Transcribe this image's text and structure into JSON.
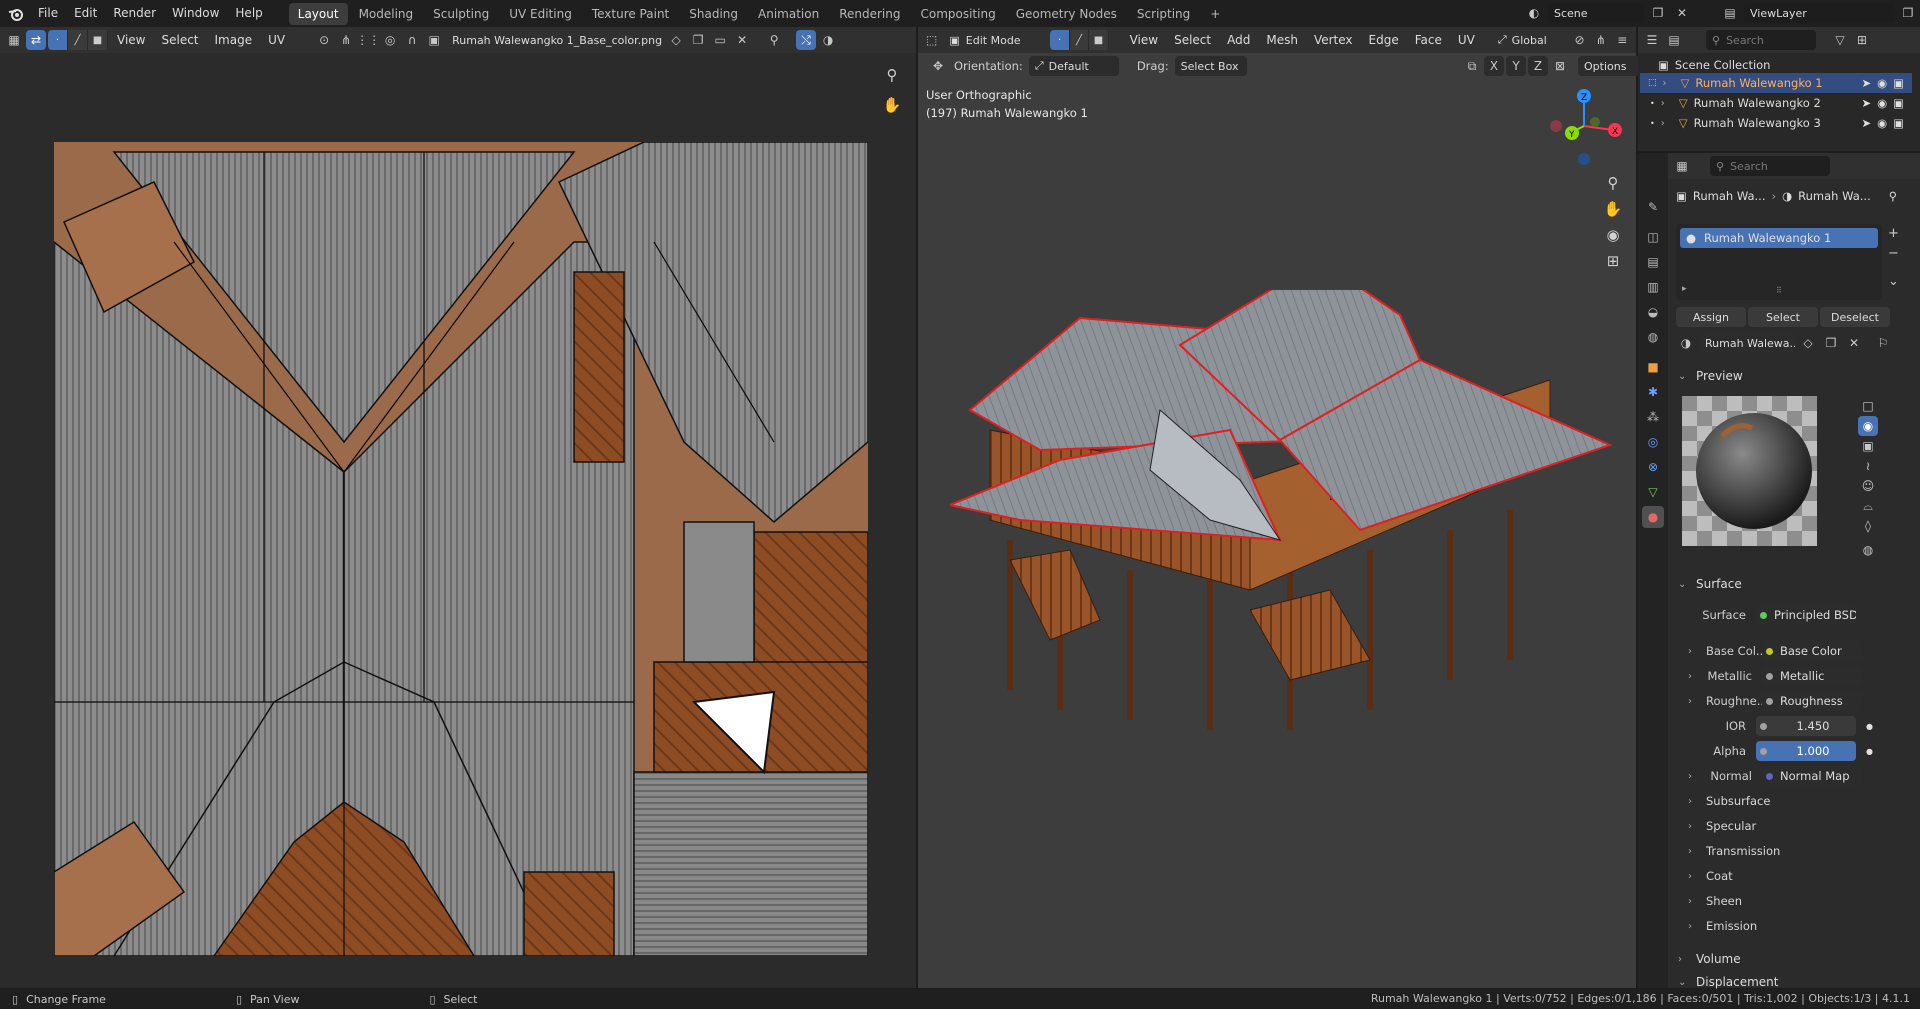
{
  "app": {
    "logo": "blender-logo"
  },
  "menu": [
    "File",
    "Edit",
    "Render",
    "Window",
    "Help"
  ],
  "workspaces": [
    "Layout",
    "Modeling",
    "Sculpting",
    "UV Editing",
    "Texture Paint",
    "Shading",
    "Animation",
    "Rendering",
    "Compositing",
    "Geometry Nodes",
    "Scripting"
  ],
  "workspace_active": "Layout",
  "add_workspace": "+",
  "scene": {
    "label": "Scene"
  },
  "view_layer": {
    "label": "ViewLayer"
  },
  "uv_editor": {
    "menus": [
      "View",
      "Select",
      "Image",
      "UV"
    ],
    "image_name": "Rumah Walewangko 1_Base_color.png"
  },
  "viewport": {
    "mode": "Edit Mode",
    "menus": [
      "View",
      "Select",
      "Add",
      "Mesh",
      "Vertex",
      "Edge",
      "Face",
      "UV"
    ],
    "transform_orientation": "Global",
    "orientation_label": "Orientation:",
    "orientation_value": "Default",
    "drag_label": "Drag:",
    "drag_value": "Select Box",
    "options_label": "Options",
    "axes": [
      "X",
      "Y",
      "Z"
    ],
    "view_name": "User Orthographic",
    "object_info": "(197) Rumah Walewangko 1"
  },
  "outliner": {
    "search_placeholder": "Search",
    "root": "Scene Collection",
    "items": [
      "Rumah Walewangko 1",
      "Rumah Walewangko 2",
      "Rumah Walewangko 3"
    ]
  },
  "properties": {
    "search_placeholder": "Search",
    "breadcrumb": [
      "Rumah Wa...",
      "Rumah Wa..."
    ],
    "material_slot": "Rumah Walewangko 1",
    "buttons": {
      "assign": "Assign",
      "select": "Select",
      "deselect": "Deselect"
    },
    "material_name": "Rumah Walewa...",
    "panels": {
      "preview": "Preview",
      "surface": "Surface"
    },
    "surface": {
      "label": "Surface",
      "value": "Principled BSDF"
    },
    "inputs": [
      {
        "label": "Base Col...",
        "value": "Base Color",
        "socket": "#c7c729"
      },
      {
        "label": "Metallic",
        "value": "Metallic",
        "socket": "#a1a1a1"
      },
      {
        "label": "Roughne...",
        "value": "Roughness",
        "socket": "#a1a1a1"
      }
    ],
    "ior": {
      "label": "IOR",
      "value": "1.450"
    },
    "alpha": {
      "label": "Alpha",
      "value": "1.000"
    },
    "normal": {
      "label": "Normal",
      "value": "Normal Map"
    },
    "subpanels": [
      "Subsurface",
      "Specular",
      "Transmission",
      "Coat",
      "Sheen",
      "Emission"
    ],
    "volume": "Volume",
    "displacement": "Displacement"
  },
  "statusbar": {
    "left": [
      {
        "icon": "mouse-left-icon",
        "label": "Change Frame"
      },
      {
        "icon": "mouse-middle-icon",
        "label": "Pan View"
      },
      {
        "icon": "mouse-right-icon",
        "label": "Select"
      }
    ],
    "stats": "Rumah Walewangko 1 | Verts:0/752 | Edges:0/1,186 | Faces:0/501 | Tris:1,002 | Objects:1/3 | 4.1.1"
  },
  "colors": {
    "accent": "#4772b3",
    "selected_edge": "#e02020",
    "roof_metal": "#8a8a8a",
    "wood": "#8a4a22",
    "axis_x": "#ff3352",
    "axis_y": "#8bdc00",
    "axis_z": "#2890ff"
  }
}
